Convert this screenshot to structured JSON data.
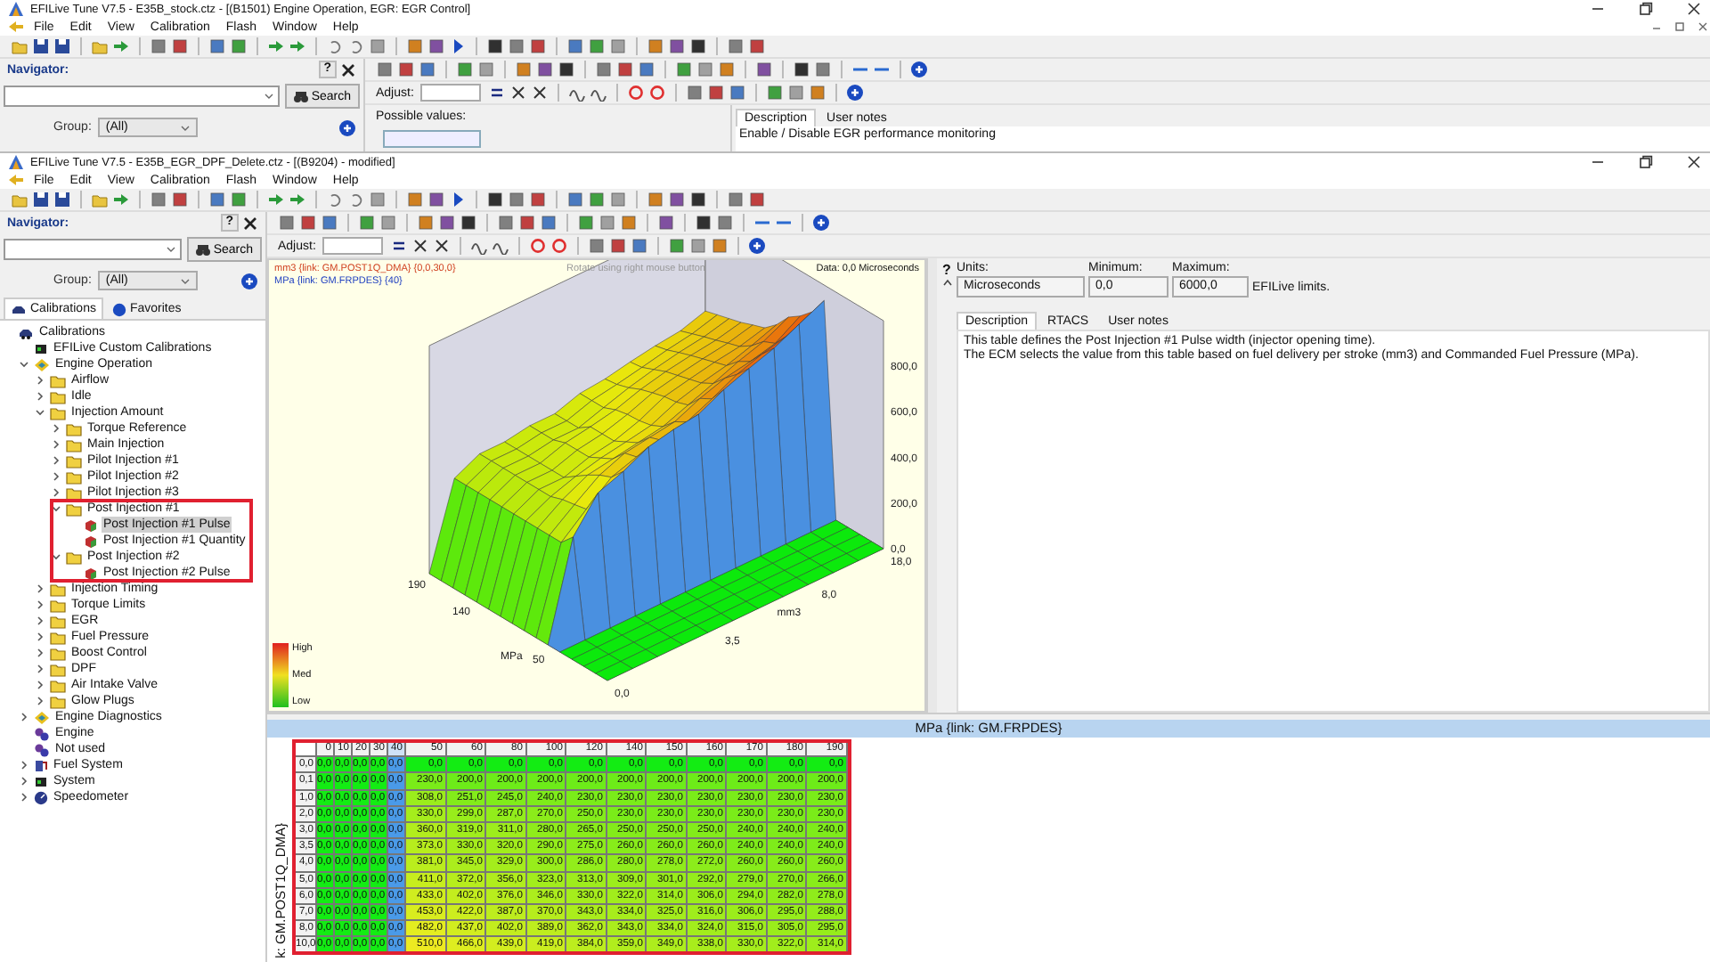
{
  "background_window": {
    "title": "EFILive Tune V7.5 - E35B_stock.ctz - [(B1501) Engine Operation, EGR: EGR Control]",
    "menu": [
      "File",
      "Edit",
      "View",
      "Calibration",
      "Flash",
      "Window",
      "Help"
    ],
    "navigator": {
      "title": "Navigator:",
      "help": "?",
      "search_button": "Search",
      "group_label": "Group:",
      "group_value": "(All)"
    },
    "adjust_label": "Adjust:",
    "possible_values_label": "Possible values:",
    "tabs": [
      {
        "label": "Description",
        "selected": true
      },
      {
        "label": "User notes",
        "selected": false
      }
    ],
    "description": [
      "Enable / Disable EGR performance monitoring"
    ]
  },
  "main_window": {
    "title": "EFILive Tune V7.5 - E35B_EGR_DPF_Delete.ctz - [(B9204) - modified]",
    "menu": [
      "File",
      "Edit",
      "View",
      "Calibration",
      "Flash",
      "Window",
      "Help"
    ],
    "navigator": {
      "title": "Navigator:",
      "help": "?",
      "search_button": "Search",
      "group_label": "Group:",
      "group_value": "(All)",
      "tabs": [
        {
          "label": "Calibrations",
          "selected": true
        },
        {
          "label": "Favorites",
          "selected": false
        }
      ],
      "tree": [
        {
          "label": "Calibrations",
          "kind": "car",
          "selected": false,
          "highlighted": false,
          "children": [
            {
              "label": "EFILive Custom Calibrations",
              "kind": "chip",
              "selected": false,
              "highlighted": false
            },
            {
              "label": "Engine Operation",
              "kind": "arrows",
              "expanded": true,
              "selected": false,
              "highlighted": false,
              "children": [
                {
                  "label": "Airflow",
                  "kind": "folder",
                  "expanded": false,
                  "selected": false,
                  "highlighted": false
                },
                {
                  "label": "Idle",
                  "kind": "folder",
                  "expanded": false,
                  "selected": false,
                  "highlighted": false
                },
                {
                  "label": "Injection Amount",
                  "kind": "folder",
                  "expanded": true,
                  "selected": false,
                  "highlighted": false,
                  "children": [
                    {
                      "label": "Torque Reference",
                      "kind": "folder",
                      "expanded": false,
                      "selected": false,
                      "highlighted": false
                    },
                    {
                      "label": "Main Injection",
                      "kind": "folder",
                      "expanded": false,
                      "selected": false,
                      "highlighted": false
                    },
                    {
                      "label": "Pilot Injection #1",
                      "kind": "folder",
                      "expanded": false,
                      "selected": false,
                      "highlighted": false
                    },
                    {
                      "label": "Pilot Injection #2",
                      "kind": "folder",
                      "expanded": false,
                      "selected": false,
                      "highlighted": false
                    },
                    {
                      "label": "Pilot Injection #3",
                      "kind": "folder",
                      "expanded": false,
                      "selected": false,
                      "highlighted": false
                    },
                    {
                      "label": "Post Injection #1",
                      "kind": "folder",
                      "expanded": true,
                      "selected": false,
                      "highlighted": true,
                      "children": [
                        {
                          "label": "Post Injection #1 Pulse",
                          "kind": "table",
                          "selected": true,
                          "highlighted": false
                        },
                        {
                          "label": "Post Injection #1 Quantity",
                          "kind": "table",
                          "selected": false,
                          "highlighted": false
                        }
                      ]
                    },
                    {
                      "label": "Post Injection #2",
                      "kind": "folder",
                      "expanded": true,
                      "selected": false,
                      "highlighted": true,
                      "children": [
                        {
                          "label": "Post Injection #2 Pulse",
                          "kind": "table",
                          "selected": false,
                          "highlighted": false
                        }
                      ]
                    }
                  ]
                },
                {
                  "label": "Injection Timing",
                  "kind": "folder",
                  "expanded": false,
                  "selected": false,
                  "highlighted": false
                },
                {
                  "label": "Torque Limits",
                  "kind": "folder",
                  "expanded": false,
                  "selected": false,
                  "highlighted": false
                },
                {
                  "label": "EGR",
                  "kind": "folder",
                  "expanded": false,
                  "selected": false,
                  "highlighted": false
                },
                {
                  "label": "Fuel Pressure",
                  "kind": "folder",
                  "expanded": false,
                  "selected": false,
                  "highlighted": false
                },
                {
                  "label": "Boost Control",
                  "kind": "folder",
                  "expanded": false,
                  "selected": false,
                  "highlighted": false
                },
                {
                  "label": "DPF",
                  "kind": "folder",
                  "expanded": false,
                  "selected": false,
                  "highlighted": false
                },
                {
                  "label": "Air Intake Valve",
                  "kind": "folder",
                  "expanded": false,
                  "selected": false,
                  "highlighted": false
                },
                {
                  "label": "Glow Plugs",
                  "kind": "folder",
                  "expanded": false,
                  "selected": false,
                  "highlighted": false
                }
              ]
            },
            {
              "label": "Engine Diagnostics",
              "kind": "arrows",
              "expanded": false,
              "selected": false,
              "highlighted": false
            },
            {
              "label": "Engine",
              "kind": "gear",
              "selected": false,
              "highlighted": false
            },
            {
              "label": "Not used",
              "kind": "gear",
              "selected": false,
              "highlighted": false
            },
            {
              "label": "Fuel System",
              "kind": "pump",
              "expanded": false,
              "selected": false,
              "highlighted": false
            },
            {
              "label": "System",
              "kind": "chip",
              "expanded": false,
              "selected": false,
              "highlighted": false
            },
            {
              "label": "Speedometer",
              "kind": "gauge",
              "expanded": false,
              "selected": false,
              "highlighted": false
            }
          ]
        }
      ]
    },
    "adjust_label": "Adjust:",
    "chart": {
      "links": [
        {
          "text": "mm3 {link: GM.POST1Q_DMA} {0,0,30,0}",
          "color": "#d04020"
        },
        {
          "text": "MPa {link: GM.FRPDES} {40}",
          "color": "#2040c0"
        }
      ],
      "hint": "Rotate using right mouse button",
      "readout": "Data: 0,0 Microseconds",
      "z_ticks": [
        "800,0",
        "600,0",
        "400,0",
        "200,0",
        "0,0"
      ],
      "mpa_label": "MPa",
      "mpa_ticks": [
        "50",
        "140",
        "190"
      ],
      "mm3_label": "mm3",
      "mm3_ticks": [
        "0,0",
        "3,5",
        "8,0",
        "18,0"
      ],
      "legend": [
        "High",
        "Med",
        "Low"
      ]
    },
    "info": {
      "help": "?",
      "units_label": "Units:",
      "minimum_label": "Minimum:",
      "maximum_label": "Maximum:",
      "units": "Microseconds",
      "minimum": "0,0",
      "maximum": "6000,0",
      "limits_note": "EFILive limits.",
      "tabs": [
        {
          "label": "Description",
          "selected": true
        },
        {
          "label": "RTACS",
          "selected": false
        },
        {
          "label": "User notes",
          "selected": false
        }
      ],
      "description": [
        "This table defines the Post Injection #1 Pulse width (injector opening time).",
        "The ECM selects the value from this table based on fuel delivery per stroke (mm3) and Commanded Fuel Pressure (MPa)."
      ]
    },
    "table": {
      "title": "MPa {link: GM.FRPDES}",
      "row_axis_label": "k: GM.POST1Q_DMA}",
      "highlighted": true,
      "columns": [
        {
          "label": "0",
          "selected": false
        },
        {
          "label": "10",
          "selected": false
        },
        {
          "label": "20",
          "selected": false
        },
        {
          "label": "30",
          "selected": false
        },
        {
          "label": "40",
          "selected": true
        },
        {
          "label": "50",
          "selected": false
        },
        {
          "label": "60",
          "selected": false
        },
        {
          "label": "80",
          "selected": false
        },
        {
          "label": "100",
          "selected": false
        },
        {
          "label": "120",
          "selected": false
        },
        {
          "label": "140",
          "selected": false
        },
        {
          "label": "150",
          "selected": false
        },
        {
          "label": "160",
          "selected": false
        },
        {
          "label": "170",
          "selected": false
        },
        {
          "label": "180",
          "selected": false
        },
        {
          "label": "190",
          "selected": false
        }
      ],
      "rows": [
        {
          "label": "0,0",
          "cells": [
            "0,0",
            "0,0",
            "0,0",
            "0,0",
            "0,0",
            "0,0",
            "0,0",
            "0,0",
            "0,0",
            "0,0",
            "0,0",
            "0,0",
            "0,0",
            "0,0",
            "0,0",
            "0,0"
          ]
        },
        {
          "label": "0,1",
          "cells": [
            "0,0",
            "0,0",
            "0,0",
            "0,0",
            "0,0",
            "230,0",
            "200,0",
            "200,0",
            "200,0",
            "200,0",
            "200,0",
            "200,0",
            "200,0",
            "200,0",
            "200,0",
            "200,0"
          ]
        },
        {
          "label": "1,0",
          "cells": [
            "0,0",
            "0,0",
            "0,0",
            "0,0",
            "0,0",
            "308,0",
            "251,0",
            "245,0",
            "240,0",
            "230,0",
            "230,0",
            "230,0",
            "230,0",
            "230,0",
            "230,0",
            "230,0"
          ]
        },
        {
          "label": "2,0",
          "cells": [
            "0,0",
            "0,0",
            "0,0",
            "0,0",
            "0,0",
            "330,0",
            "299,0",
            "287,0",
            "270,0",
            "250,0",
            "230,0",
            "230,0",
            "230,0",
            "230,0",
            "230,0",
            "230,0"
          ]
        },
        {
          "label": "3,0",
          "cells": [
            "0,0",
            "0,0",
            "0,0",
            "0,0",
            "0,0",
            "360,0",
            "319,0",
            "311,0",
            "280,0",
            "265,0",
            "250,0",
            "250,0",
            "250,0",
            "240,0",
            "240,0",
            "240,0"
          ]
        },
        {
          "label": "3,5",
          "cells": [
            "0,0",
            "0,0",
            "0,0",
            "0,0",
            "0,0",
            "373,0",
            "330,0",
            "320,0",
            "290,0",
            "275,0",
            "260,0",
            "260,0",
            "260,0",
            "240,0",
            "240,0",
            "240,0"
          ]
        },
        {
          "label": "4,0",
          "cells": [
            "0,0",
            "0,0",
            "0,0",
            "0,0",
            "0,0",
            "381,0",
            "345,0",
            "329,0",
            "300,0",
            "286,0",
            "280,0",
            "278,0",
            "272,0",
            "260,0",
            "260,0",
            "260,0"
          ]
        },
        {
          "label": "5,0",
          "cells": [
            "0,0",
            "0,0",
            "0,0",
            "0,0",
            "0,0",
            "411,0",
            "372,0",
            "356,0",
            "323,0",
            "313,0",
            "309,0",
            "301,0",
            "292,0",
            "279,0",
            "270,0",
            "266,0"
          ]
        },
        {
          "label": "6,0",
          "cells": [
            "0,0",
            "0,0",
            "0,0",
            "0,0",
            "0,0",
            "433,0",
            "402,0",
            "376,0",
            "346,0",
            "330,0",
            "322,0",
            "314,0",
            "306,0",
            "294,0",
            "282,0",
            "278,0"
          ]
        },
        {
          "label": "7,0",
          "cells": [
            "0,0",
            "0,0",
            "0,0",
            "0,0",
            "0,0",
            "453,0",
            "422,0",
            "387,0",
            "370,0",
            "343,0",
            "334,0",
            "325,0",
            "316,0",
            "306,0",
            "295,0",
            "288,0"
          ]
        },
        {
          "label": "8,0",
          "cells": [
            "0,0",
            "0,0",
            "0,0",
            "0,0",
            "0,0",
            "482,0",
            "437,0",
            "402,0",
            "389,0",
            "362,0",
            "343,0",
            "334,0",
            "324,0",
            "315,0",
            "305,0",
            "295,0"
          ]
        },
        {
          "label": "10,0",
          "cells": [
            "0,0",
            "0,0",
            "0,0",
            "0,0",
            "0,0",
            "510,0",
            "466,0",
            "439,0",
            "419,0",
            "384,0",
            "359,0",
            "349,0",
            "338,0",
            "330,0",
            "322,0",
            "314,0"
          ]
        }
      ]
    }
  }
}
